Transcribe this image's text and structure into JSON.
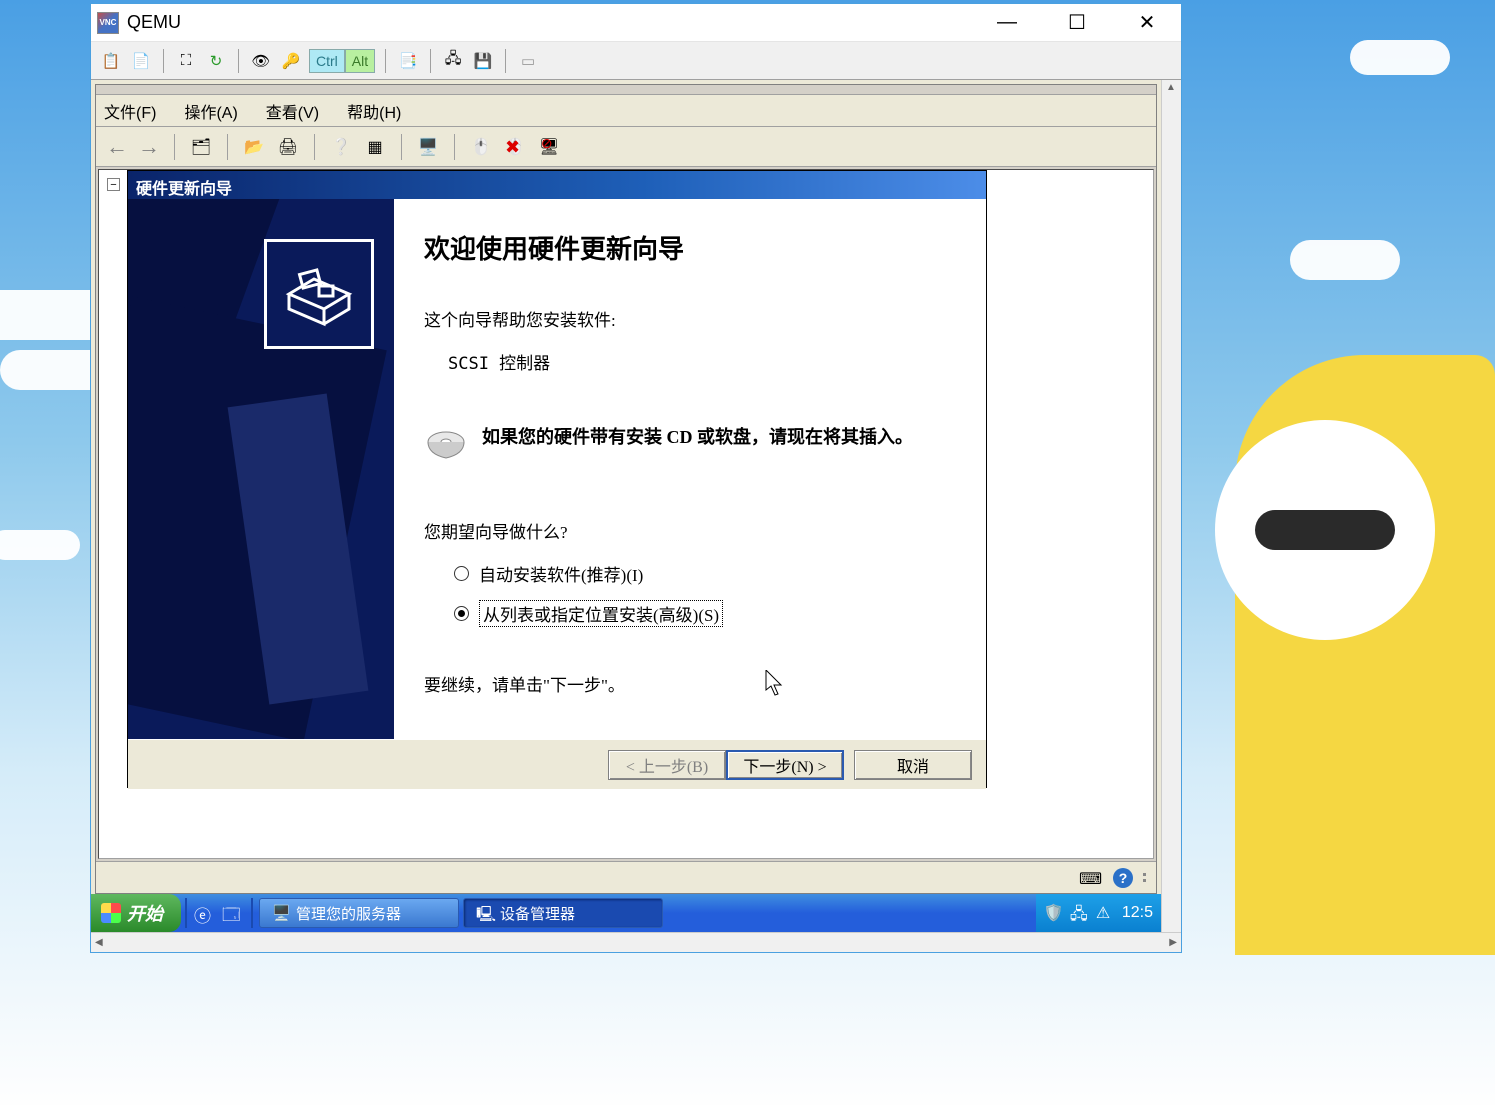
{
  "vnc": {
    "title": "QEMU",
    "ctrl": "Ctrl",
    "alt": "Alt"
  },
  "mmc": {
    "menu": {
      "file": "文件(F)",
      "action": "操作(A)",
      "view": "查看(V)",
      "help": "帮助(H)"
    }
  },
  "wizard": {
    "title": "硬件更新向导",
    "heading": "欢迎使用硬件更新向导",
    "intro": "这个向导帮助您安装软件:",
    "device": "SCSI 控制器",
    "cd_hint": "如果您的硬件带有安装 CD 或软盘，请现在将其插入。",
    "question": "您期望向导做什么?",
    "opt_auto": "自动安装软件(推荐)(I)",
    "opt_list": "从列表或指定位置安装(高级)(S)",
    "continue": "要继续，请单击\"下一步\"。",
    "back": "< 上一步(B)",
    "next": "下一步(N) >",
    "cancel": "取消"
  },
  "taskbar": {
    "start": "开始",
    "task1": "管理您的服务器",
    "task2": "设备管理器",
    "clock": "12:5"
  }
}
